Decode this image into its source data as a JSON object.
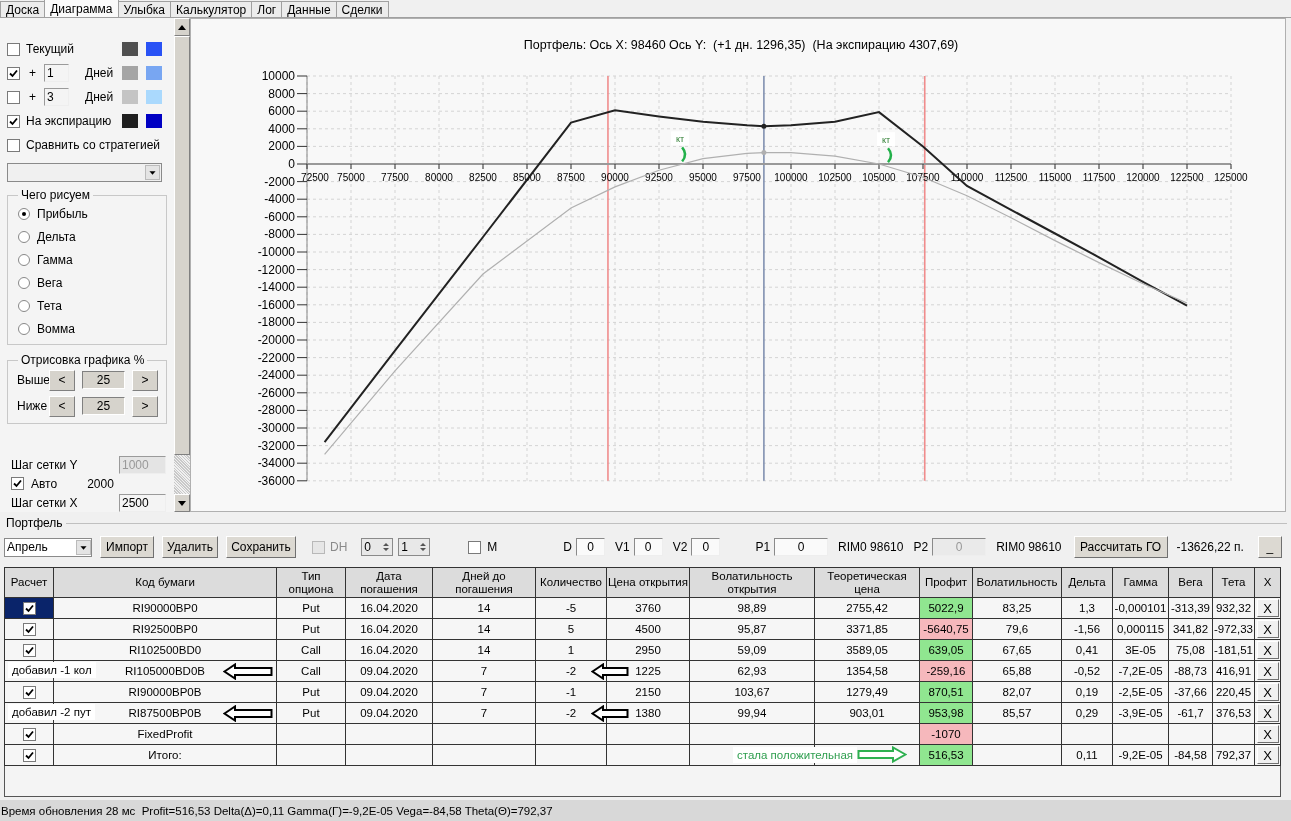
{
  "tabs": [
    {
      "label": "Доска",
      "selected": false
    },
    {
      "label": "Диаграмма",
      "selected": true
    },
    {
      "label": "Улыбка",
      "selected": false
    },
    {
      "label": "Калькулятор",
      "selected": false
    },
    {
      "label": "Лог",
      "selected": false
    },
    {
      "label": "Данные",
      "selected": false
    },
    {
      "label": "Сделки",
      "selected": false
    }
  ],
  "sidebar": {
    "curves": [
      {
        "kind": "plain",
        "label": "Текущий",
        "checked": false,
        "swatches": [
          {
            "color": "#505050"
          },
          {
            "color": "#2952f5"
          }
        ]
      },
      {
        "kind": "days",
        "prefix": "+",
        "days": "1",
        "unit": "Дней",
        "checked": true,
        "swatches": [
          {
            "color": "#a5a5a5"
          },
          {
            "color": "#78a6f2"
          }
        ]
      },
      {
        "kind": "days",
        "prefix": "+",
        "days": "3",
        "unit": "Дней",
        "checked": false,
        "swatches": [
          {
            "color": "#c4c4c4"
          },
          {
            "color": "#aad9fd"
          }
        ]
      },
      {
        "kind": "plain",
        "label": "На экспирацию",
        "checked": true,
        "swatches": [
          {
            "color": "#1f1f1f"
          },
          {
            "color": "#0000c3"
          }
        ]
      }
    ],
    "compare": {
      "label": "Сравнить со стратегией",
      "checked": false
    },
    "what_to_draw": {
      "title": "Чего рисуем",
      "options": [
        {
          "label": "Прибыль",
          "selected": true
        },
        {
          "label": "Дельта",
          "selected": false
        },
        {
          "label": "Гамма",
          "selected": false
        },
        {
          "label": "Вега",
          "selected": false
        },
        {
          "label": "Тета",
          "selected": false
        },
        {
          "label": "Вомма",
          "selected": false
        }
      ]
    },
    "drawing": {
      "title": "Отрисовка графика %",
      "rows": [
        {
          "label": "Выше",
          "decrease": "<",
          "value": "25",
          "increase": ">"
        },
        {
          "label": "Ниже",
          "decrease": "<",
          "value": "25",
          "increase": ">"
        }
      ]
    },
    "grid_y": {
      "label": "Шаг сетки Y",
      "value": "1000",
      "disabled": true
    },
    "auto": {
      "label": "Авто",
      "checked": true,
      "value": "2000"
    },
    "grid_x": {
      "label": "Шаг сетки X",
      "value": "2500",
      "disabled": false
    }
  },
  "chart": {
    "chart_data": {
      "type": "line",
      "title": "Портфель: Ось X: 98460 Ось Y:  (+1 дн. 1296,35)  (На экспирацию 4307,69)",
      "x": [
        73500,
        77500,
        82500,
        87500,
        90000,
        92500,
        95000,
        97500,
        98460,
        100000,
        102500,
        105000,
        107500,
        110000,
        112500,
        115000,
        117500,
        120000,
        122500
      ],
      "series": [
        {
          "color": "#222222",
          "values": [
            -31600,
            -21200,
            -8300,
            4700,
            6100,
            5400,
            4800,
            4400,
            4300,
            4400,
            4800,
            5900,
            2000,
            -2500,
            -5200,
            -7900,
            -10600,
            -13400,
            -16100
          ]
        },
        {
          "color": "#b0b0b0",
          "values": [
            -33000,
            -23500,
            -12500,
            -5000,
            -2600,
            -700,
            600,
            1200,
            1300,
            1300,
            900,
            0,
            -1500,
            -3600,
            -6100,
            -8700,
            -11200,
            -13600,
            -15800
          ]
        }
      ],
      "xlim": [
        72500,
        125000
      ],
      "ylim": [
        -36000,
        10000
      ],
      "xticks": [
        72500,
        75000,
        77500,
        80000,
        82500,
        85000,
        87500,
        90000,
        92500,
        95000,
        97500,
        100000,
        102500,
        105000,
        107500,
        110000,
        112500,
        115000,
        117500,
        120000,
        122500,
        125000
      ],
      "yticks": [
        10000,
        8000,
        6000,
        4000,
        2000,
        0,
        -2000,
        -4000,
        -6000,
        -8000,
        -10000,
        -12000,
        -14000,
        -16000,
        -18000,
        -20000,
        -22000,
        -24000,
        -26000,
        -28000,
        -30000,
        -32000,
        -34000,
        -36000
      ],
      "grid": true,
      "ref_lines": [
        {
          "axis": "x",
          "value": 89600,
          "color": "#f08c8c"
        },
        {
          "axis": "x",
          "value": 107600,
          "color": "#f08c8c"
        },
        {
          "axis": "x",
          "value": 98460,
          "color": "#8090b0"
        }
      ],
      "annotations": [
        {
          "text": "кт",
          "x": 93700,
          "y": 2800
        },
        {
          "text": "кт",
          "x": 105400,
          "y": 2700
        }
      ]
    }
  },
  "portfolio": {
    "title": "Портфель",
    "month": "Апрель",
    "buttons": [
      "Импорт",
      "Удалить",
      "Сохранить"
    ],
    "dh": {
      "label": "DH",
      "checked": false,
      "disabled": true
    },
    "spinners": [
      "0",
      "1"
    ],
    "m": {
      "label": "M",
      "checked": false
    },
    "fields": [
      {
        "label": "D",
        "value": "0",
        "disabled": false
      },
      {
        "label": "V1",
        "value": "0",
        "disabled": false
      },
      {
        "label": "V2",
        "value": "0",
        "disabled": false
      },
      {
        "label": "P1",
        "value": "0",
        "disabled": false,
        "after": "RIM0 98610"
      },
      {
        "label": "P2",
        "value": "0",
        "disabled": true,
        "after": "RIM0 98610"
      }
    ],
    "calc_button": "Рассчитать ГО",
    "margin": "-13626,22 п.",
    "minimize": "_"
  },
  "table": {
    "columns": [
      "Расчет",
      "Код бумаги",
      "Тип опциона",
      "Дата погашения",
      "Дней до погашения",
      "Количество",
      "Цена открытия",
      "Волатильность открытия",
      "Теоретическая цена",
      "Профит",
      "Волатильность",
      "Дельта",
      "Гамма",
      "Вега",
      "Тета",
      "X"
    ],
    "rows": [
      {
        "selected": true,
        "checked": true,
        "cells": [
          null,
          "RI90000BP0",
          "Put",
          "16.04.2020",
          "14",
          "-5",
          "3760",
          "98,89",
          "2755,42",
          "5022,9",
          "83,25",
          "1,3",
          "-0,000101",
          "-313,39",
          "932,32"
        ],
        "color": "#90e690",
        "delete": "X"
      },
      {
        "selected": false,
        "checked": true,
        "cells": [
          null,
          "RI92500BP0",
          "Put",
          "16.04.2020",
          "14",
          "5",
          "4500",
          "95,87",
          "3371,85",
          "-5640,75",
          "79,6",
          "-1,56",
          "0,000115",
          "341,82",
          "-972,33"
        ],
        "color": "#f6b8bc",
        "delete": "X"
      },
      {
        "selected": false,
        "checked": true,
        "cells": [
          null,
          "RI102500BD0",
          "Call",
          "16.04.2020",
          "14",
          "1",
          "2950",
          "59,09",
          "3589,05",
          "639,05",
          "67,65",
          "0,41",
          "3E-05",
          "75,08",
          "-181,51"
        ],
        "color": "#90e690",
        "delete": "X"
      },
      {
        "selected": false,
        "note": "добавил -1 кол",
        "arrows": true,
        "cells": [
          null,
          "RI105000BD0B",
          "Call",
          "09.04.2020",
          "7",
          "-2",
          "1225",
          "62,93",
          "1354,58",
          "-259,16",
          "65,88",
          "-0,52",
          "-7,2E-05",
          "-88,73",
          "416,91"
        ],
        "color": "#f6b8bc",
        "delete": "X"
      },
      {
        "selected": false,
        "checked": true,
        "cells": [
          null,
          "RI90000BP0B",
          "Put",
          "09.04.2020",
          "7",
          "-1",
          "2150",
          "103,67",
          "1279,49",
          "870,51",
          "82,07",
          "0,19",
          "-2,5E-05",
          "-37,66",
          "220,45"
        ],
        "color": "#90e690",
        "delete": "X"
      },
      {
        "selected": false,
        "note": "добавил -2 пут",
        "arrows": true,
        "cells": [
          null,
          "RI87500BP0B",
          "Put",
          "09.04.2020",
          "7",
          "-2",
          "1380",
          "99,94",
          "903,01",
          "953,98",
          "85,57",
          "0,29",
          "-3,9E-05",
          "-61,7",
          "376,53"
        ],
        "color": "#90e690",
        "delete": "X"
      },
      {
        "selected": false,
        "checked": true,
        "cells": [
          null,
          "FixedProfit",
          null,
          null,
          null,
          null,
          null,
          null,
          null,
          "-1070",
          null,
          null,
          null,
          null,
          null
        ],
        "color": "#f6b8bc",
        "delete": "X"
      },
      {
        "selected": false,
        "checked": true,
        "cells": [
          null,
          "Итого:",
          null,
          null,
          null,
          null,
          null,
          null,
          null,
          "516,53",
          null,
          "0,11",
          "-9,2E-05",
          "-84,58",
          "792,37"
        ],
        "color": "#90e690",
        "delete": "X",
        "callout": "стала положительная"
      }
    ]
  },
  "status_bar": "Время обновления 28 мс  Profit=516,53 Delta(Δ)=0,11 Gamma(Γ)=-9,2E-05 Vega=-84,58 Theta(Θ)=792,37"
}
